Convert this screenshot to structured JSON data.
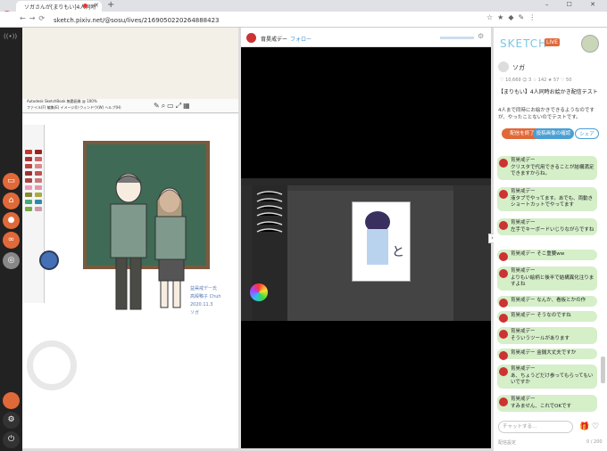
{
  "browser": {
    "tab_title": "ソガさんが[まりもい]4人同時",
    "url": "sketch.pixiv.net/@sosu/lives/2169050220264888423",
    "new_tab": "+",
    "window_controls": "– ☐ ✕"
  },
  "broadcaster": {
    "name": "育昊戒デー",
    "follow": "フォロー"
  },
  "drawing": {
    "title": "Autodesk SketchBook 無題画像 @ 100%",
    "menu": "ファイル(F) 編集(E) イメージ(I) ウィンドウ(W) ヘルプ(H)",
    "signature": "益昊戒デー氏\n高殿鴨子 Chuh\n2020.11.3\nソガ"
  },
  "chat_panel": {
    "logo": "SKETCH",
    "live": "LIVE",
    "user": "ソガ",
    "stats": "♡ 10,669  ☺ 3  ♢ 142  ★ 57  ♡ 50",
    "stream_title": "【まりもい】4人同時お絵かき配信テスト",
    "stream_desc": "4人まで同時にお絵かきできるようなのですが、やったことないのでテストです。",
    "btn_end": "配信を終了",
    "btn_activity": "投稿画像の確認",
    "btn_share": "シェア",
    "input_placeholder": "チャットする...",
    "footer": "配信設定",
    "counter": "0 / 200"
  },
  "messages": [
    {
      "name": "育昊戒デー",
      "text": "クリスタで代用できることが結構満足できますからね。"
    },
    {
      "name": "育昊戒デー",
      "text": "液タブでやってます。あでも、両動きショートカットでやってます"
    },
    {
      "name": "育昊戒デー",
      "text": "左手でキーボードいじりながらですね"
    },
    {
      "name": "育昊戒デー",
      "text": "そこ重要ww"
    },
    {
      "name": "育昊戒デー",
      "text": "よりもい絵柄と後半で結構異化注りますよね"
    },
    {
      "name": "育昊戒デー",
      "text": "なんか、看板とかの作"
    },
    {
      "name": "育昊戒デー",
      "text": "そうなのですね"
    },
    {
      "name": "育昊戒デー",
      "text": "そういうツールがあります"
    },
    {
      "name": "育昊戒デー",
      "text": "金銭大丈夫ですか"
    },
    {
      "name": "育昊戒デー",
      "text": "あ、ちょうどだけ参ってもらってもいいですか"
    },
    {
      "name": "育昊戒デー",
      "text": "すみません、これでOKです"
    }
  ]
}
